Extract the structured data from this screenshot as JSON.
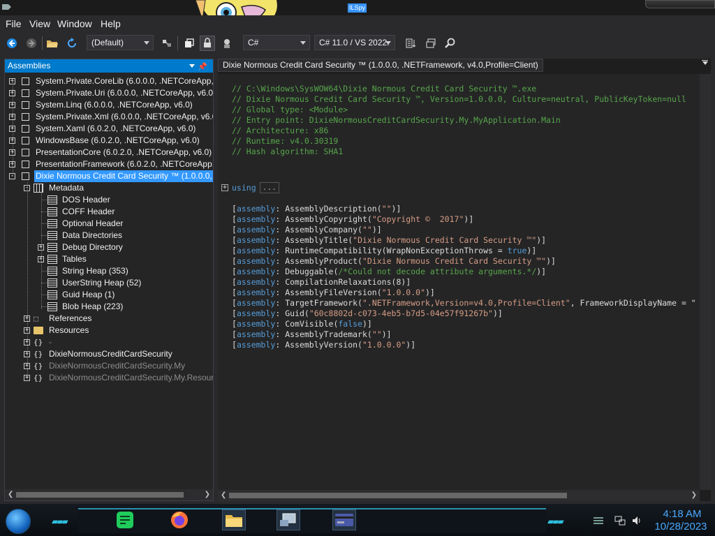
{
  "titlebar": {
    "app_badge": "ILSpy"
  },
  "menu": {
    "file": "File",
    "view": "View",
    "window": "Window",
    "help": "Help"
  },
  "toolbar": {
    "filter_value": "(Default)",
    "language_value": "C#",
    "version_value": "C# 11.0 / VS 2022.",
    "icons": [
      "back-icon",
      "forward-icon",
      "open-icon",
      "reload-icon",
      "filter-icon",
      "show-public-icon",
      "show-private-icon",
      "show-all-icon",
      "sort-icon",
      "new-window-icon",
      "search-icon"
    ]
  },
  "left": {
    "header": "Assemblies",
    "items": [
      {
        "label": "System.Private.CoreLib (6.0.0.0, .NETCoreApp, v6"
      },
      {
        "label": "System.Private.Uri (6.0.0.0, .NETCoreApp, v6.0)"
      },
      {
        "label": "System.Linq (6.0.0.0, .NETCoreApp, v6.0)"
      },
      {
        "label": "System.Private.Xml (6.0.0.0, .NETCoreApp, v6.0)"
      },
      {
        "label": "System.Xaml (6.0.2.0, .NETCoreApp, v6.0)"
      },
      {
        "label": "WindowsBase (6.0.2.0, .NETCoreApp, v6.0)"
      },
      {
        "label": "PresentationCore (6.0.2.0, .NETCoreApp, v6.0)"
      },
      {
        "label": "PresentationFramework (6.0.2.0, .NETCoreApp, v"
      },
      {
        "label": "Dixie Normous Credit Card Security ™ (1.0.0.0, .N"
      }
    ],
    "metadata": {
      "label": "Metadata",
      "children": [
        {
          "label": "DOS Header"
        },
        {
          "label": "COFF Header"
        },
        {
          "label": "Optional Header"
        },
        {
          "label": "Data Directories"
        },
        {
          "label": "Debug Directory"
        },
        {
          "label": "Tables"
        },
        {
          "label": "String Heap (353)"
        },
        {
          "label": "UserString Heap (52)"
        },
        {
          "label": "Guid Heap (1)"
        },
        {
          "label": "Blob Heap (223)"
        }
      ]
    },
    "references": "References",
    "resources": "Resources",
    "namespaces": [
      {
        "label": "-"
      },
      {
        "label": "DixieNormousCreditCardSecurity"
      },
      {
        "label": "DixieNormousCreditCardSecurity.My"
      },
      {
        "label": "DixieNormousCreditCardSecurity.My.Resour"
      }
    ]
  },
  "right": {
    "tab_title": "Dixie Normous Credit Card Security ™ (1.0.0.0, .NETFramework, v4.0,Profile=Client)",
    "comments": [
      "// C:\\Windows\\SysWOW64\\Dixie Normous Credit Card Security ™.exe",
      "// Dixie Normous Credit Card Security ™, Version=1.0.0.0, Culture=neutral, PublicKeyToken=null",
      "// Global type: <Module>",
      "// Entry point: DixieNormousCreditCardSecurity.My.MyApplication.Main",
      "// Architecture: x86",
      "// Runtime: v4.0.30319",
      "// Hash algorithm: SHA1"
    ],
    "using_keyword": "using",
    "using_collapsed": "...",
    "attrs": {
      "kw": "assembly",
      "description": {
        "name": "AssemblyDescription",
        "arg": "\"\""
      },
      "copyright": {
        "name": "AssemblyCopyright",
        "arg": "\"Copyright ©  2017\""
      },
      "company": {
        "name": "AssemblyCompany",
        "arg": "\"\""
      },
      "title": {
        "name": "AssemblyTitle",
        "arg": "\"Dixie Normous Credit Card Security ™\""
      },
      "runtime": {
        "name": "RuntimeCompatibility",
        "pre": "WrapNonExceptionThrows = ",
        "kwarg": "true"
      },
      "product": {
        "name": "AssemblyProduct",
        "arg": "\"Dixie Normous Credit Card Security ™\""
      },
      "debuggable": {
        "name": "Debuggable",
        "comment": "/*Could not decode attribute arguments.*/"
      },
      "relax": {
        "name": "CompilationRelaxations",
        "num": "8"
      },
      "fileversion": {
        "name": "AssemblyFileVersion",
        "arg": "\"1.0.0.0\""
      },
      "target": {
        "name": "TargetFramework",
        "arg": "\".NETFramework,Version=v4.0,Profile=Client\"",
        "rest": ", FrameworkDisplayName = \""
      },
      "guid": {
        "name": "Guid",
        "arg": "\"60c8802d-c073-4eb5-b7d5-04e57f91267b\""
      },
      "comvisible": {
        "name": "ComVisible",
        "kwarg": "false"
      },
      "trademark": {
        "name": "AssemblyTrademark",
        "arg": "\"\""
      },
      "version": {
        "name": "AssemblyVersion",
        "arg": "\"1.0.0.0\""
      }
    }
  },
  "taskbar": {
    "apps": [
      "start-orb",
      "notes-app-icon",
      "firefox-icon",
      "file-explorer-icon",
      "network-app-icon",
      "card-app-icon"
    ],
    "time": "4:18 AM",
    "date": "10/28/2023"
  },
  "colors": {
    "accent": "#007acc",
    "selection": "#3399ff",
    "comment": "#57a64a",
    "keyword": "#569cd6",
    "string": "#d69d85",
    "clock": "#4aa8ff"
  }
}
